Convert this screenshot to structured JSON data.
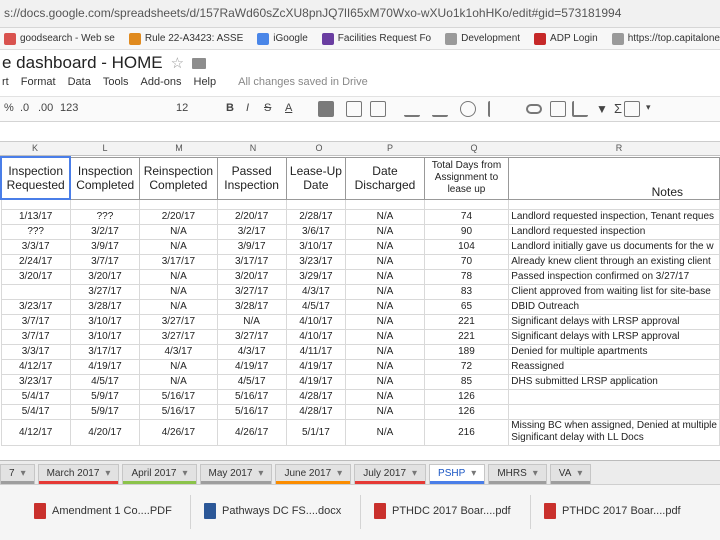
{
  "browser": {
    "url": "s://docs.google.com/spreadsheets/d/157RaWd60sZcXU8pnJQ7lI65xM70Wxo-wXUo1k1ohHKo/edit#gid=573181994",
    "bookmarks": [
      {
        "label": "goodsearch - Web se",
        "color": "#d9534f"
      },
      {
        "label": "Rule 22-A3423: ASSE",
        "color": "#e08a1e"
      },
      {
        "label": "iGoogle",
        "color": "#4a86e8"
      },
      {
        "label": "Facilities Request Fo",
        "color": "#6a3ea1"
      },
      {
        "label": "Development",
        "color": "#9a9a9a"
      },
      {
        "label": "ADP Login",
        "color": "#c62828"
      },
      {
        "label": "https://top.capitalone",
        "color": "#9a9a9a"
      }
    ]
  },
  "doc": {
    "title": "e dashboard - HOME",
    "menu": [
      "rt",
      "Format",
      "Data",
      "Tools",
      "Add-ons",
      "Help"
    ],
    "saved_status": "All changes saved in Drive"
  },
  "toolbar": {
    "percent": "%",
    "decimals0": ".0",
    "decimals00": ".00",
    "format": "123",
    "font_size": "12",
    "bold": "B",
    "italic": "I",
    "strike": "S",
    "text_color": "A",
    "sigma": "Σ"
  },
  "grid": {
    "col_letters": [
      "K",
      "L",
      "M",
      "N",
      "O",
      "P",
      "Q",
      "R"
    ],
    "headers": [
      "Inspection Requested",
      "Inspection Completed",
      "Reinspection Completed",
      "Passed Inspection",
      "Lease-Up Date",
      "Date Discharged",
      "Total Days from Assignment to lease up",
      "Notes"
    ],
    "rows": [
      [
        "1/13/17",
        "???",
        "2/20/17",
        "2/20/17",
        "2/28/17",
        "N/A",
        "74",
        "Landlord requested inspection, Tenant reques"
      ],
      [
        "???",
        "3/2/17",
        "N/A",
        "3/2/17",
        "3/6/17",
        "N/A",
        "90",
        "Landlord requested inspection"
      ],
      [
        "3/3/17",
        "3/9/17",
        "N/A",
        "3/9/17",
        "3/10/17",
        "N/A",
        "104",
        "Landlord initially gave us documents for the w"
      ],
      [
        "2/24/17",
        "3/7/17",
        "3/17/17",
        "3/17/17",
        "3/23/17",
        "N/A",
        "70",
        "Already knew client through an existing client"
      ],
      [
        "3/20/17",
        "3/20/17",
        "N/A",
        "3/20/17",
        "3/29/17",
        "N/A",
        "78",
        "Passed inspection confirmed on 3/27/17"
      ],
      [
        "",
        "3/27/17",
        "N/A",
        "3/27/17",
        "4/3/17",
        "N/A",
        "83",
        "Client approved from waiting list for site-base"
      ],
      [
        "3/23/17",
        "3/28/17",
        "N/A",
        "3/28/17",
        "4/5/17",
        "N/A",
        "65",
        "DBID Outreach"
      ],
      [
        "3/7/17",
        "3/10/17",
        "3/27/17",
        "N/A",
        "4/10/17",
        "N/A",
        "221",
        "Significant delays with LRSP approval"
      ],
      [
        "3/7/17",
        "3/10/17",
        "3/27/17",
        "3/27/17",
        "4/10/17",
        "N/A",
        "221",
        "Significant delays with LRSP approval"
      ],
      [
        "3/3/17",
        "3/17/17",
        "4/3/17",
        "4/3/17",
        "4/11/17",
        "N/A",
        "189",
        "Denied for multiple apartments"
      ],
      [
        "4/12/17",
        "4/19/17",
        "N/A",
        "4/19/17",
        "4/19/17",
        "N/A",
        "72",
        "Reassigned"
      ],
      [
        "3/23/17",
        "4/5/17",
        "N/A",
        "4/5/17",
        "4/19/17",
        "N/A",
        "85",
        "DHS submitted LRSP application"
      ],
      [
        "5/4/17",
        "5/9/17",
        "5/16/17",
        "5/16/17",
        "4/28/17",
        "N/A",
        "126",
        ""
      ],
      [
        "5/4/17",
        "5/9/17",
        "5/16/17",
        "5/16/17",
        "4/28/17",
        "N/A",
        "126",
        ""
      ],
      [
        "4/12/17",
        "4/20/17",
        "4/26/17",
        "4/26/17",
        "5/1/17",
        "N/A",
        "216",
        "Missing BC when assigned, Denied at multiple",
        "Significant delay with LL Docs"
      ]
    ]
  },
  "tabs": [
    {
      "label": "7",
      "color": "#9e9e9e",
      "active": false
    },
    {
      "label": "March 2017",
      "color": "#e53935",
      "active": false
    },
    {
      "label": "April 2017",
      "color": "#8bc34a",
      "active": false
    },
    {
      "label": "May 2017",
      "color": "#9e9e9e",
      "active": false
    },
    {
      "label": "June 2017",
      "color": "#fb8c00",
      "active": false
    },
    {
      "label": "July 2017",
      "color": "#e53935",
      "active": false
    },
    {
      "label": "PSHP",
      "color": "#4a7ee8",
      "active": true
    },
    {
      "label": "MHRS",
      "color": "#9e9e9e",
      "active": false
    },
    {
      "label": "VA",
      "color": "#9e9e9e",
      "active": false
    }
  ],
  "downloads": [
    {
      "label": "Amendment 1 Co....PDF",
      "kind": "pdf"
    },
    {
      "label": "Pathways DC FS....docx",
      "kind": "doc"
    },
    {
      "label": "PTHDC 2017 Boar....pdf",
      "kind": "pdf"
    },
    {
      "label": "PTHDC 2017 Boar....pdf",
      "kind": "pdf"
    }
  ]
}
